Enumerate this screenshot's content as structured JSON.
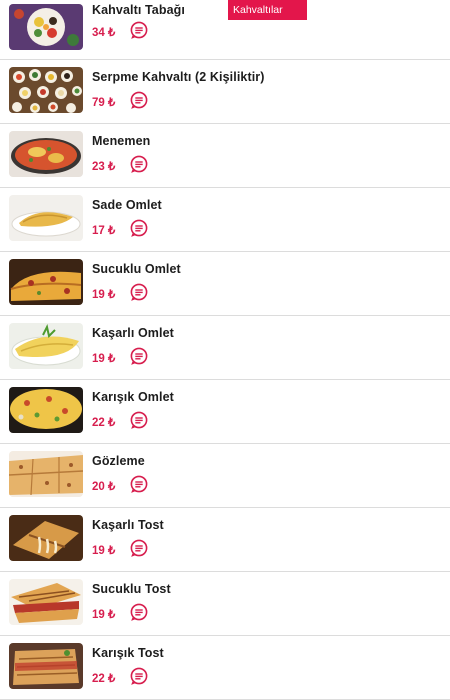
{
  "category_label": "Kahvaltılar",
  "items": [
    {
      "name": "Kahvaltı Tabağı",
      "price": "34 ₺",
      "icon": "message-lines-icon",
      "photo": "breakfast-plate-photo"
    },
    {
      "name": "Serpme Kahvaltı (2 Kişiliktir)",
      "price": "79 ₺",
      "icon": "message-lines-icon",
      "photo": "spread-breakfast-photo"
    },
    {
      "name": "Menemen",
      "price": "23 ₺",
      "icon": "message-lines-icon",
      "photo": "menemen-photo"
    },
    {
      "name": "Sade Omlet",
      "price": "17 ₺",
      "icon": "message-lines-icon",
      "photo": "plain-omelette-photo"
    },
    {
      "name": "Sucuklu Omlet",
      "price": "19 ₺",
      "icon": "message-lines-icon",
      "photo": "sucuk-omelette-photo"
    },
    {
      "name": "Kaşarlı Omlet",
      "price": "19 ₺",
      "icon": "message-lines-icon",
      "photo": "cheese-omelette-photo"
    },
    {
      "name": "Karışık Omlet",
      "price": "22 ₺",
      "icon": "message-lines-icon",
      "photo": "mixed-omelette-photo"
    },
    {
      "name": "Gözleme",
      "price": "20 ₺",
      "icon": "message-lines-icon",
      "photo": "gozleme-photo"
    },
    {
      "name": "Kaşarlı Tost",
      "price": "19 ₺",
      "icon": "message-lines-icon",
      "photo": "cheese-toast-photo"
    },
    {
      "name": "Sucuklu Tost",
      "price": "19 ₺",
      "icon": "message-lines-icon",
      "photo": "sucuk-toast-photo"
    },
    {
      "name": "Karışık Tost",
      "price": "22 ₺",
      "icon": "message-lines-icon",
      "photo": "mixed-toast-photo"
    }
  ],
  "colors": {
    "accent": "#d71e4e",
    "tag": "#e3164b"
  }
}
